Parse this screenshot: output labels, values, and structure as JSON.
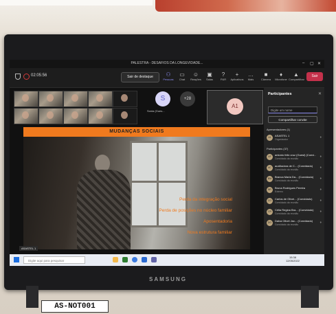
{
  "window": {
    "title": "PALESTRA - DESAFIOS DA LONGEVIDADE..."
  },
  "toolbar": {
    "timer": "02:05:56",
    "leave_spotlight": "Sair de destaque",
    "items": [
      {
        "label": "Pessoas",
        "icon": "people-icon"
      },
      {
        "label": "Chat",
        "icon": "chat-icon"
      },
      {
        "label": "Reações",
        "icon": "reactions-icon"
      },
      {
        "label": "Salas",
        "icon": "rooms-icon"
      },
      {
        "label": "P&R",
        "icon": "qa-icon"
      },
      {
        "label": "Aplicativos",
        "icon": "apps-icon"
      },
      {
        "label": "Mais",
        "icon": "more-icon"
      },
      {
        "label": "Câmera",
        "icon": "camera-icon"
      },
      {
        "label": "Microfone",
        "icon": "microphone-icon"
      },
      {
        "label": "Compartilhar",
        "icon": "share-icon"
      }
    ],
    "leave": "Sair",
    "accent": "#c4314b"
  },
  "stage": {
    "sonia_initial": "S",
    "sonia_name": "Sonia (Gues...",
    "more_count": "+28",
    "self_initials": "A1",
    "presenter": "ASASTEL 1",
    "slide": {
      "title": "MUDANÇAS SOCIAIS",
      "bullets": [
        "Perda da integração social",
        "Perda de posições no núcleo familiar",
        "Aposentadoria",
        "Nova estrutura familiar"
      ],
      "accent": "#f07a1e"
    }
  },
  "panel": {
    "title": "Participantes",
    "search_placeholder": "Digite um nome",
    "share_invite": "Compartilhar convite",
    "presenters_header": "Apresentadores (1)",
    "presenter": {
      "initials": "A1",
      "name": "ASASTEL 1",
      "role": "Organizador"
    },
    "attendees_header": "Participantes (37)",
    "attendees": [
      {
        "initials": "AF",
        "name": "antonio felix cruz (Guest) (Convi...",
        "role": "Convidado da reunião"
      },
      {
        "initials": "AC",
        "name": "auxiliadora de C... (Convidado)",
        "role": "Convidado da reunião"
      },
      {
        "initials": "BM",
        "name": "Branca Maria Da... (Convidado)",
        "role": "Convidado da reunião"
      },
      {
        "initials": "BR",
        "name": "Bruna Rodrigues Pereira",
        "role": "Externo"
      },
      {
        "initials": "CO",
        "name": "Carlos de Olivei... (Convidado)",
        "role": "Convidado da reunião"
      },
      {
        "initials": "CR",
        "name": "Célia Regina Bra... (Convidado)",
        "role": "Convidado da reunião"
      },
      {
        "initials": "DO",
        "name": "Dalva Olivet Jac... (Convidado)",
        "role": "Convidado da reunião"
      }
    ]
  },
  "taskbar": {
    "search_placeholder": "Digite aqui para pesquisar",
    "time": "15:38",
    "date": "12/05/2022"
  },
  "device": {
    "brand": "SAMSUNG",
    "asset_label": "AS-NOT001"
  }
}
